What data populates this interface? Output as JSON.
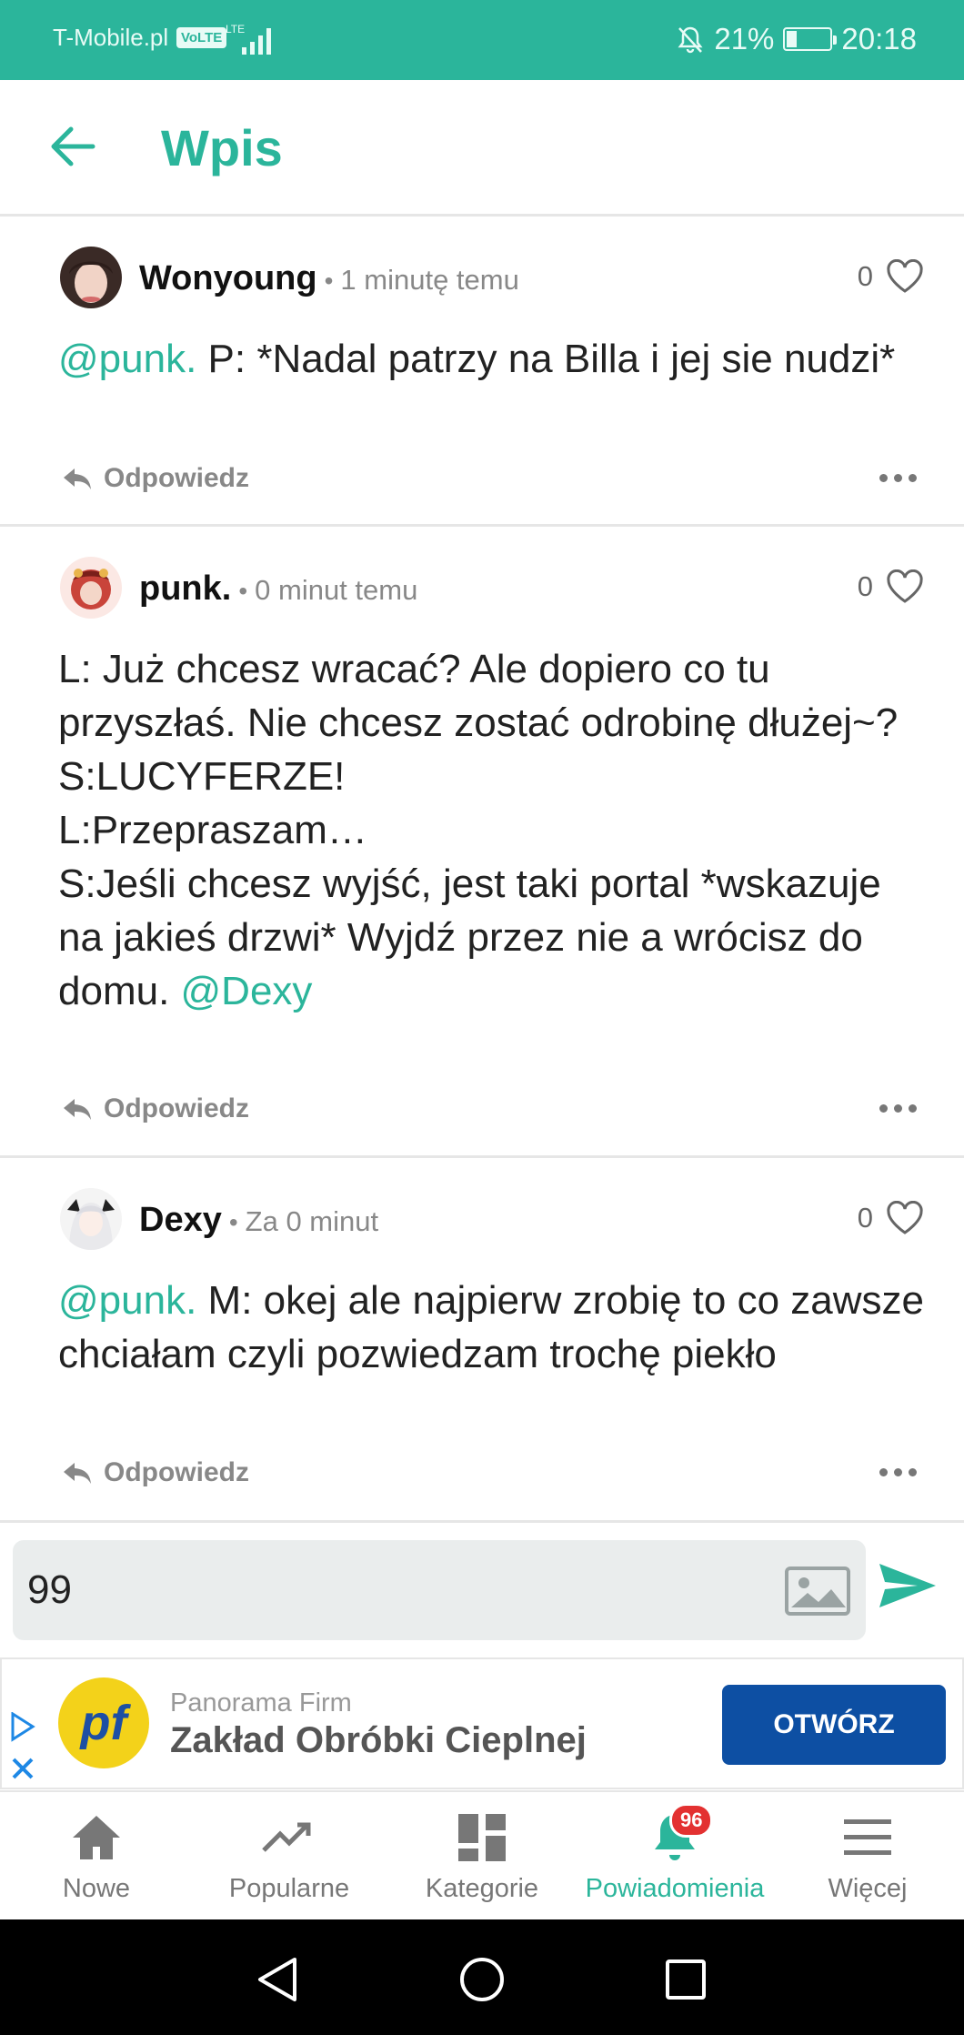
{
  "status_bar": {
    "carrier": "T-Mobile.pl",
    "volte": "VoLTE",
    "network": "LTE",
    "battery": "21%",
    "battery_level": 0.21,
    "time": "20:18"
  },
  "header": {
    "title": "Wpis"
  },
  "posts": [
    {
      "author": "Wonyoung",
      "time": "1 minutę temu",
      "likes": "0",
      "mention": "@punk.",
      "text": " P: *Nadal patrzy na Billa i jej sie nudzi*",
      "reply_label": "Odpowiedz"
    },
    {
      "author": "punk.",
      "time": "0 minut temu",
      "likes": "0",
      "lines": [
        "L: Już chcesz wracać? Ale dopiero co tu przyszłaś. Nie chcesz zostać odrobinę dłużej~?",
        "S:LUCYFERZE!",
        "L:Przepraszam…",
        "S:Jeśli chcesz wyjść, jest taki portal *wskazuje na jakieś drzwi* Wyjdź przez nie a wrócisz do domu. "
      ],
      "mention": "@Dexy",
      "reply_label": "Odpowiedz"
    },
    {
      "author": "Dexy",
      "time": "Za 0 minut",
      "likes": "0",
      "mention": "@punk.",
      "text": " M: okej ale najpierw zrobię to co zawsze chciałam czyli pozwiedzam trochę piekło",
      "reply_label": "Odpowiedz"
    }
  ],
  "compose": {
    "value": "99"
  },
  "ad": {
    "brand": "Panorama Firm",
    "headline": "Zakład Obróbki Cieplnej",
    "cta": "OTWÓRZ",
    "logo_text": "pf"
  },
  "bottom_nav": [
    {
      "label": "Nowe",
      "icon": "home-icon"
    },
    {
      "label": "Popularne",
      "icon": "trending-icon"
    },
    {
      "label": "Kategorie",
      "icon": "categories-icon"
    },
    {
      "label": "Powiadomienia",
      "icon": "bell-icon",
      "badge": "96",
      "active": true
    },
    {
      "label": "Więcej",
      "icon": "menu-icon"
    }
  ],
  "colors": {
    "accent": "#2bb59b",
    "badge": "#e33131",
    "cta": "#0d4fa3"
  }
}
